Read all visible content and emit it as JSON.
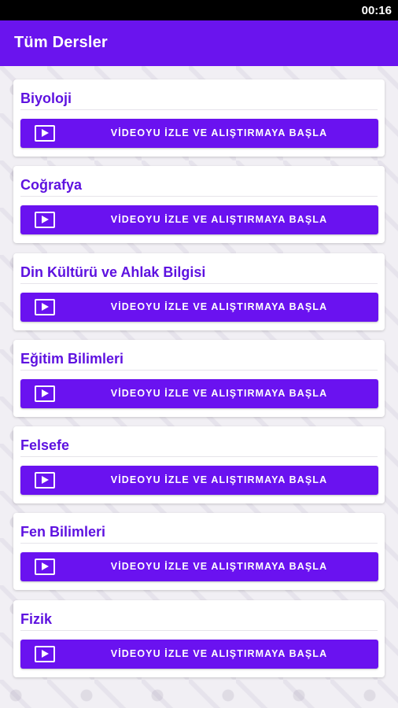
{
  "statusbar": {
    "time": "00:16"
  },
  "appbar": {
    "title": "Tüm Dersler"
  },
  "colors": {
    "primary": "#6a12f0",
    "accent_text": "#5e12e0"
  },
  "courses": [
    {
      "name": "Biyoloji",
      "button_label": "VİDEOYU İZLE VE ALIŞTIRMAYA BAŞLA",
      "icon": "play-icon"
    },
    {
      "name": "Coğrafya",
      "button_label": "VİDEOYU İZLE VE ALIŞTIRMAYA BAŞLA",
      "icon": "play-icon"
    },
    {
      "name": "Din Kültürü ve Ahlak Bilgisi",
      "button_label": "VİDEOYU İZLE VE ALIŞTIRMAYA BAŞLA",
      "icon": "play-icon"
    },
    {
      "name": "Eğitim Bilimleri",
      "button_label": "VİDEOYU İZLE VE ALIŞTIRMAYA BAŞLA",
      "icon": "play-icon"
    },
    {
      "name": "Felsefe",
      "button_label": "VİDEOYU İZLE VE ALIŞTIRMAYA BAŞLA",
      "icon": "play-icon"
    },
    {
      "name": "Fen Bilimleri",
      "button_label": "VİDEOYU İZLE VE ALIŞTIRMAYA BAŞLA",
      "icon": "play-icon"
    },
    {
      "name": "Fizik",
      "button_label": "VİDEOYU İZLE VE ALIŞTIRMAYA BAŞLA",
      "icon": "play-icon"
    }
  ]
}
